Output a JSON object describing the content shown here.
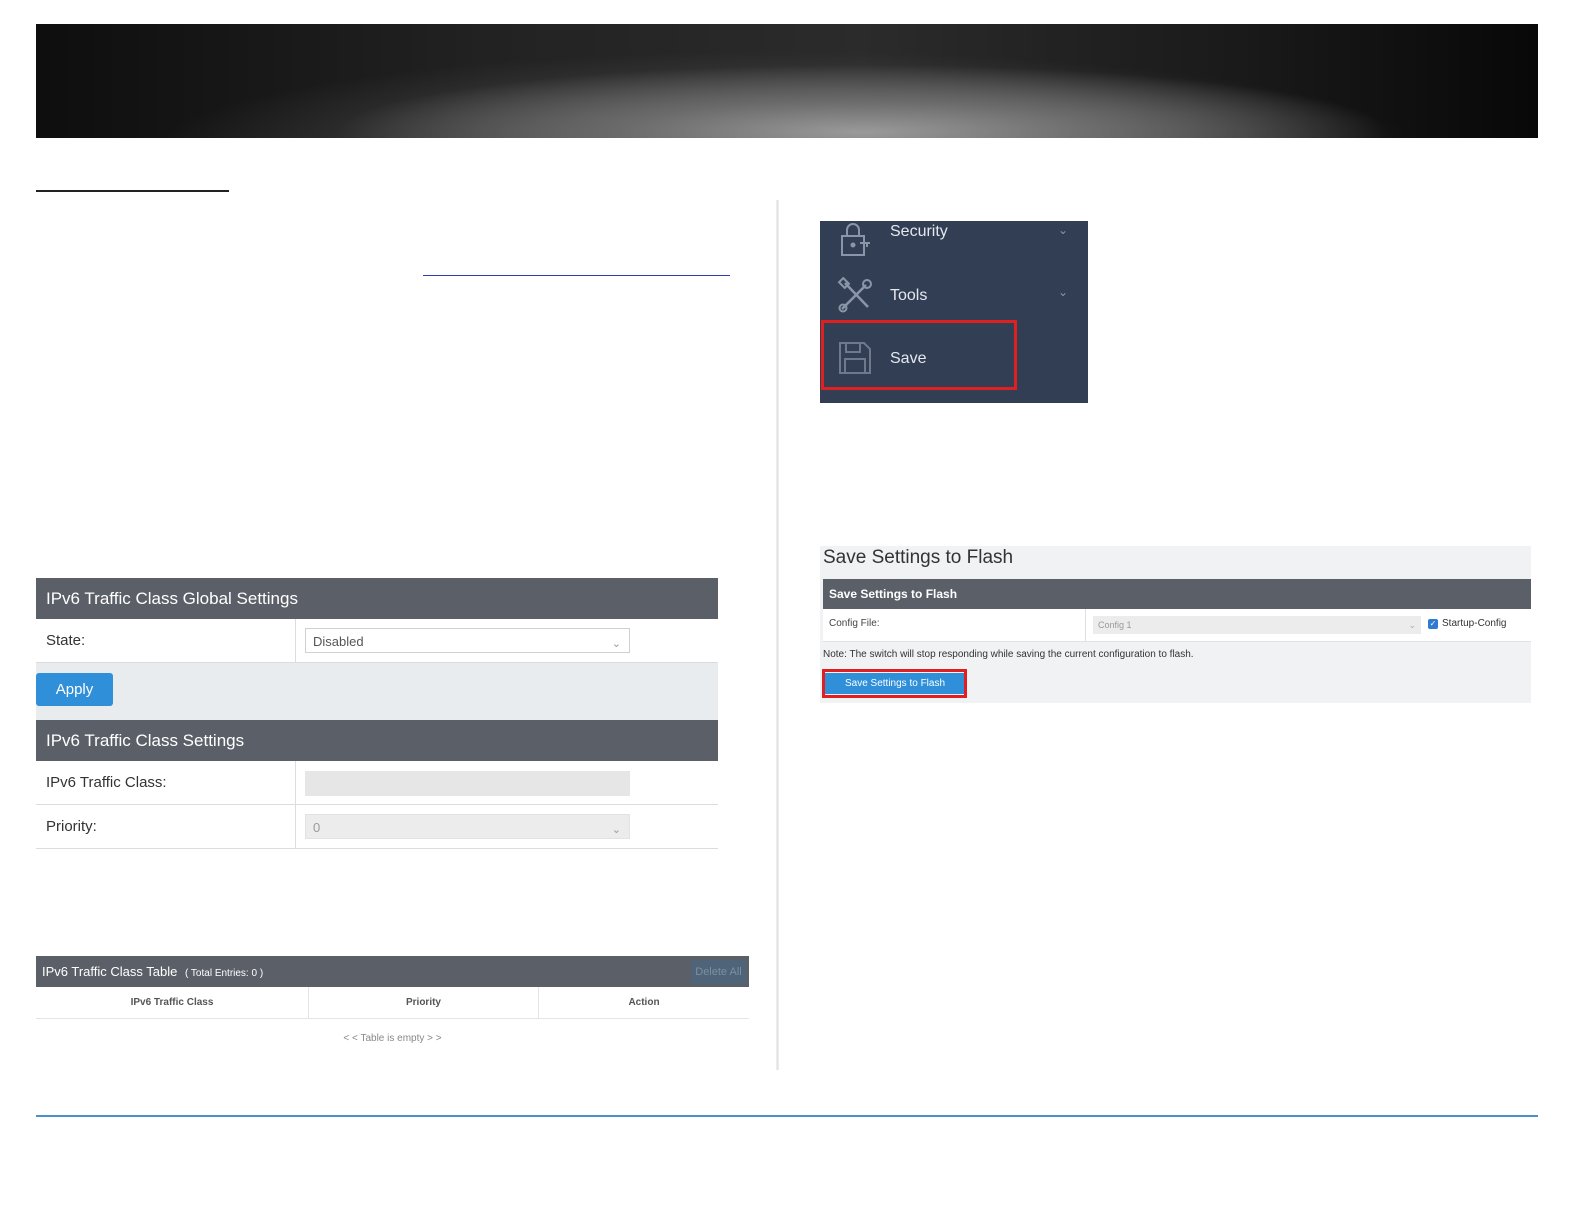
{
  "left": {
    "global_panel": {
      "title": "IPv6 Traffic Class Global Settings",
      "state_label": "State:",
      "state_value": "Disabled",
      "apply_label": "Apply"
    },
    "settings_panel": {
      "title": "IPv6 Traffic Class Settings",
      "traffic_class_label": "IPv6 Traffic Class:",
      "traffic_class_value": "",
      "priority_label": "Priority:",
      "priority_value": "0"
    },
    "table": {
      "title": "IPv6 Traffic Class Table",
      "total": "( Total Entries: 0 )",
      "delete_all_label": "Delete All",
      "columns": [
        "IPv6 Traffic Class",
        "Priority",
        "Action"
      ],
      "empty_text": "< < Table is empty > >"
    }
  },
  "menu": {
    "items": [
      {
        "label": "Security",
        "icon": "lock-icon",
        "has_chevron": true
      },
      {
        "label": "Tools",
        "icon": "tools-icon",
        "has_chevron": true
      },
      {
        "label": "Save",
        "icon": "floppy-disk-icon",
        "has_chevron": false
      }
    ]
  },
  "save_panel": {
    "title": "Save Settings to Flash",
    "header": "Save Settings to Flash",
    "config_file_label": "Config File:",
    "config_file_value": "Config 1",
    "startup_label": "Startup-Config",
    "startup_checked": true,
    "note": "Note: The switch will stop responding while saving the current configuration to flash.",
    "button_label": "Save Settings to Flash"
  },
  "colors": {
    "panel_header": "#5b6068",
    "button_blue": "#2f8fd8",
    "menu_bg": "#323e54",
    "highlight_red": "#e02020"
  }
}
